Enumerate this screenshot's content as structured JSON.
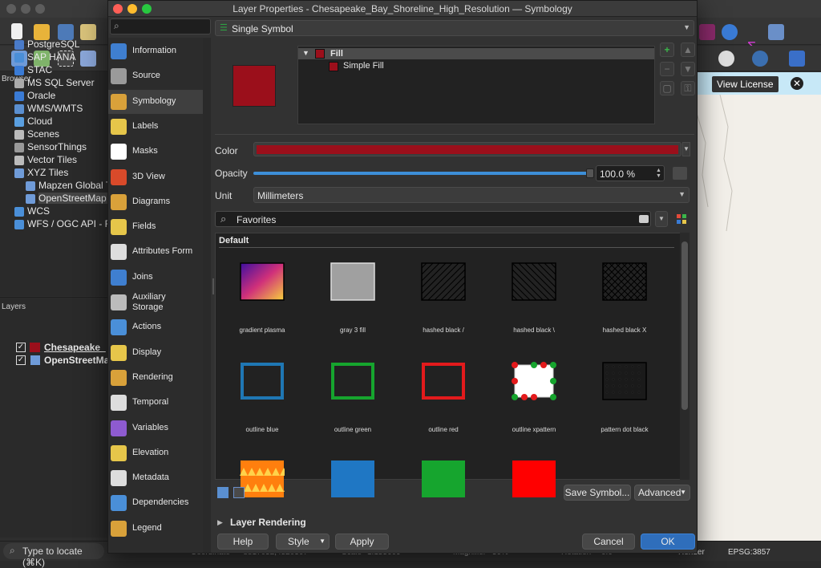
{
  "dialog": {
    "title": "Layer Properties - Chesapeake_Bay_Shoreline_High_Resolution — Symbology",
    "sidebar": [
      {
        "label": "Information",
        "icon": "info-icon",
        "color": "#3f7fd0"
      },
      {
        "label": "Source",
        "icon": "wrench-icon",
        "color": "#9a9a9a"
      },
      {
        "label": "Symbology",
        "icon": "paintbrush-icon",
        "color": "#d9a13a",
        "selected": true
      },
      {
        "label": "Labels",
        "icon": "abc-label-icon",
        "color": "#e6c64a"
      },
      {
        "label": "Masks",
        "icon": "abc-mask-icon",
        "color": "#ffffff"
      },
      {
        "label": "3D View",
        "icon": "cube-icon",
        "color": "#d94a2a"
      },
      {
        "label": "Diagrams",
        "icon": "diagram-icon",
        "color": "#d9a13a"
      },
      {
        "label": "Fields",
        "icon": "fields-icon",
        "color": "#e6c64a"
      },
      {
        "label": "Attributes Form",
        "icon": "form-icon",
        "color": "#dddddd"
      },
      {
        "label": "Joins",
        "icon": "joins-icon",
        "color": "#3f7fd0"
      },
      {
        "label": "Auxiliary Storage",
        "icon": "storage-icon",
        "color": "#bbbbbb"
      },
      {
        "label": "Actions",
        "icon": "actions-icon",
        "color": "#4a8fd8"
      },
      {
        "label": "Display",
        "icon": "display-icon",
        "color": "#e6c64a"
      },
      {
        "label": "Rendering",
        "icon": "rendering-icon",
        "color": "#d9a13a"
      },
      {
        "label": "Temporal",
        "icon": "clock-icon",
        "color": "#dddddd"
      },
      {
        "label": "Variables",
        "icon": "variables-icon",
        "color": "#8e5bd0"
      },
      {
        "label": "Elevation",
        "icon": "elevation-icon",
        "color": "#e6c64a"
      },
      {
        "label": "Metadata",
        "icon": "metadata-icon",
        "color": "#dddddd"
      },
      {
        "label": "Dependencies",
        "icon": "dependencies-icon",
        "color": "#4a8fd8"
      },
      {
        "label": "Legend",
        "icon": "legend-icon",
        "color": "#d9a13a"
      }
    ],
    "renderer": "Single Symbol",
    "tree": {
      "root": "Fill",
      "child": "Simple Fill"
    },
    "color_label": "Color",
    "opacity_label": "Opacity",
    "opacity_value": "100.0 %",
    "unit_label": "Unit",
    "unit_value": "Millimeters",
    "symbol_search": "Favorites",
    "library_heading": "Default",
    "fill_color": "#9b0f1b",
    "symbols": [
      {
        "name": "gradient  plasma",
        "kind": "gradient"
      },
      {
        "name": "gray 3 fill",
        "kind": "gray"
      },
      {
        "name": "hashed black /",
        "kind": "hash-fwd"
      },
      {
        "name": "hashed black \\",
        "kind": "hash-back"
      },
      {
        "name": "hashed black X",
        "kind": "hash-x"
      },
      {
        "name": "outline blue",
        "kind": "outline",
        "color": "#1f77b4"
      },
      {
        "name": "outline green",
        "kind": "outline",
        "color": "#16a52e"
      },
      {
        "name": "outline red",
        "kind": "outline",
        "color": "#e31a1c"
      },
      {
        "name": "outline xpattern",
        "kind": "xpattern"
      },
      {
        "name": "pattern dot black",
        "kind": "dots"
      },
      {
        "name": "",
        "kind": "orange-tri"
      },
      {
        "name": "",
        "kind": "solid",
        "color": "#1f77c4"
      },
      {
        "name": "",
        "kind": "solid",
        "color": "#16a52e"
      },
      {
        "name": "",
        "kind": "solid",
        "color": "#ff0000"
      }
    ],
    "buttons": {
      "save_symbol": "Save Symbol...",
      "advanced": "Advanced",
      "layer_rendering": "Layer Rendering",
      "help": "Help",
      "style": "Style",
      "apply": "Apply",
      "cancel": "Cancel",
      "ok": "OK"
    }
  },
  "background": {
    "browser_title": "Browser",
    "browser_items": [
      "PostgreSQL",
      "SAP HANA",
      "STAC",
      "MS SQL Server",
      "Oracle",
      "WMS/WMTS",
      "Cloud",
      "Scenes",
      "SensorThings",
      "Vector Tiles",
      "XYZ Tiles",
      "Mapzen Global T",
      "OpenStreetMap",
      "WCS",
      "WFS / OGC API - F"
    ],
    "layers_title": "Layers",
    "layers": [
      "Chesapeake_",
      "OpenStreetMa"
    ],
    "view_license": "View License",
    "locate_placeholder": "Type to locate (⌘K)",
    "status": {
      "coordinate_label": "Coordinate",
      "coordinate": "-8817052,4520307",
      "scale_label": "Scale",
      "scale": "1:155609",
      "magnifier_label": "Magnifier",
      "magnifier": "50%",
      "rotation_label": "Rotation",
      "rotation": "0.0",
      "render_label": "Render",
      "crs": "EPSG:3857"
    }
  }
}
